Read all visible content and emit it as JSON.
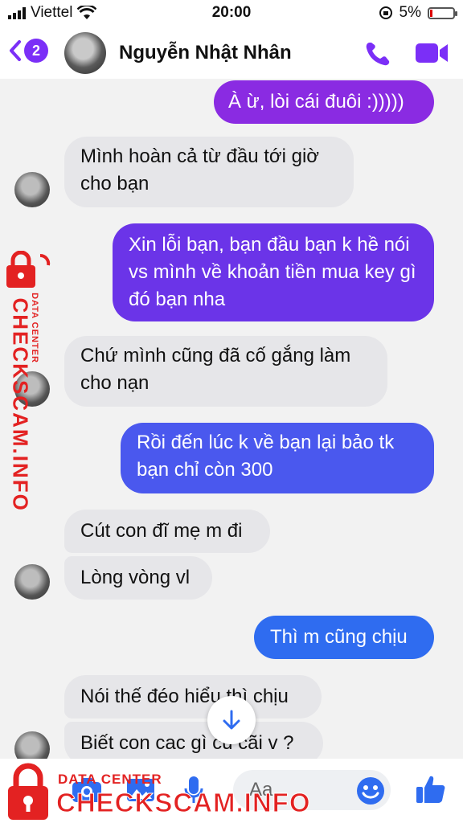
{
  "status": {
    "carrier": "Viettel",
    "time": "20:00",
    "battery": "5%"
  },
  "header": {
    "back_count": "2",
    "contact_name": "Nguyễn Nhật Nhân"
  },
  "messages": [
    {
      "dir": "out",
      "text": "À ừ, lòi cái đuôi :)))))"
    },
    {
      "dir": "in",
      "text": "Mình hoàn cả từ đầu tới giờ cho bạn"
    },
    {
      "dir": "out",
      "text": "Xin lỗi bạn, bạn đầu bạn k hề nói vs mình về khoản tiền mua key gì đó bạn nha"
    },
    {
      "dir": "in",
      "text": "Chứ mình cũng đã cố gắng làm cho nạn"
    },
    {
      "dir": "out",
      "text": "Rồi đến lúc k về bạn lại bảo tk bạn chỉ còn 300"
    },
    {
      "dir": "in",
      "text": "Cút con đĩ mẹ m đi"
    },
    {
      "dir": "in",
      "text": "Lòng vòng vl"
    },
    {
      "dir": "out",
      "text": "Thì m cũng chịu"
    },
    {
      "dir": "in",
      "text": "Nói thế đéo hiểu thì chịu"
    },
    {
      "dir": "in",
      "text": "Biết con cac gì cu cãi v ?"
    }
  ],
  "composer": {
    "placeholder": "Aa"
  },
  "watermark": {
    "small": "DATA CENTER",
    "big": "CHECKSCAM.INFO"
  },
  "colors": {
    "accent": "#7b2ff7",
    "out_top": "#8a2be2",
    "out_bottom": "#2f6cf0",
    "in_bubble": "#e6e6e9",
    "watermark": "#e32222"
  }
}
